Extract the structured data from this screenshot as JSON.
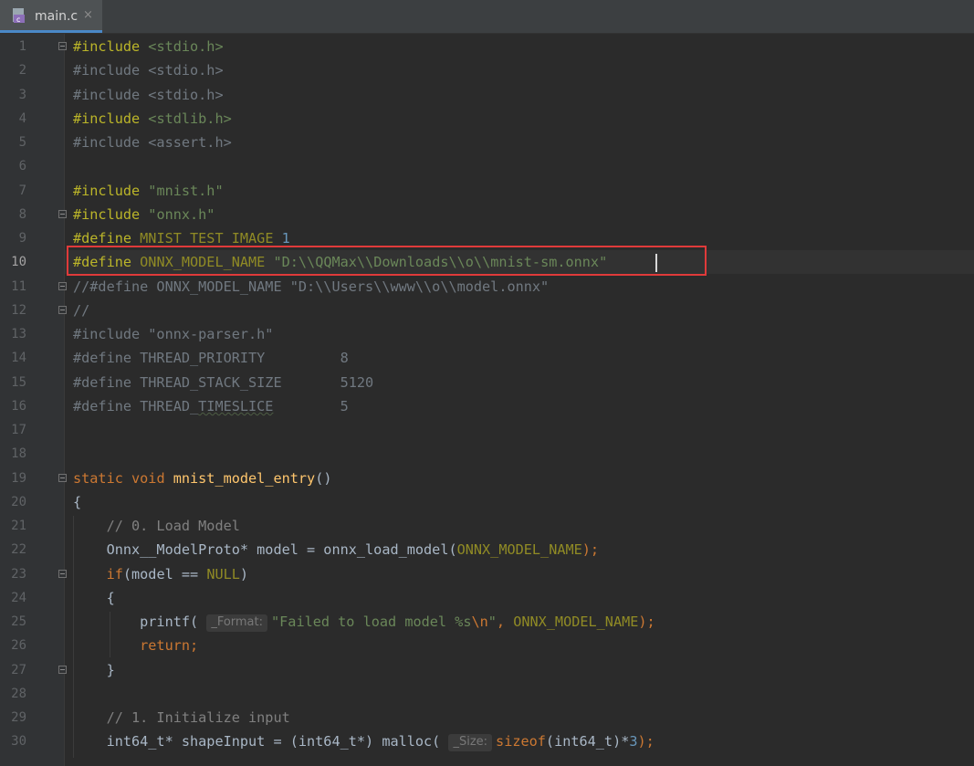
{
  "tab": {
    "file_icon": "c-file-icon",
    "name": "main.c",
    "close": "×"
  },
  "line_numbers": [
    "1",
    "2",
    "3",
    "4",
    "5",
    "6",
    "7",
    "8",
    "9",
    "10",
    "11",
    "12",
    "13",
    "14",
    "15",
    "16",
    "17",
    "18",
    "19",
    "20",
    "21",
    "22",
    "23",
    "24",
    "25",
    "26",
    "27",
    "28",
    "29",
    "30"
  ],
  "code": {
    "l1": {
      "kw": "#include",
      "arg": " <stdio.h>"
    },
    "l2": {
      "text": "#include <stdio.h>"
    },
    "l3": {
      "text": "#include <stdio.h>"
    },
    "l4": {
      "kw": "#include",
      "arg": " <stdlib.h>"
    },
    "l5": {
      "text": "#include <assert.h>"
    },
    "l7": {
      "kw": "#include",
      "arg": " \"mnist.h\""
    },
    "l8": {
      "kw": "#include",
      "arg": " \"onnx.h\""
    },
    "l9": {
      "kw": "#define",
      "name": " MNIST_TEST_IMAGE",
      "val": " 1"
    },
    "l10": {
      "kw": "#define",
      "name": " ONNX_MODEL_NAME",
      "val": " \"D:\\\\QQMax\\\\Downloads\\\\o\\\\mnist-sm.onnx\""
    },
    "l11": {
      "text": "//#define ONNX_MODEL_NAME \"D:\\\\Users\\\\www\\\\o\\\\model.onnx\""
    },
    "l12": {
      "text": "//"
    },
    "l13": {
      "text": "#include \"onnx-parser.h\""
    },
    "l14": {
      "text": "#define THREAD_PRIORITY         8"
    },
    "l15": {
      "text": "#define THREAD_STACK_SIZE       5120"
    },
    "l16": {
      "pre": "#define THREAD_",
      "squig": "TIMESLICE",
      "post": "        5"
    },
    "l19": {
      "kw1": "static",
      "kw2": " void",
      "fn": " mnist_model_entry",
      "rest": "()"
    },
    "l20": {
      "text": "{"
    },
    "l21": {
      "text": "    // 0. Load Model"
    },
    "l22": {
      "pre": "    Onnx__ModelProto* model = onnx_load_model(",
      "macro": "ONNX_MODEL_NAME",
      "post": ");"
    },
    "l23": {
      "kw": "    if",
      "mid": "(model == ",
      "macro": "NULL",
      "post": ")"
    },
    "l24": {
      "text": "    {"
    },
    "l25": {
      "pre": "        printf( ",
      "hint": "_Format:",
      "str": "\"Failed to load model %s",
      "esc": "\\n",
      "str2": "\"",
      ", ": ", ",
      "macro": "ONNX_MODEL_NAME",
      "post": ");"
    },
    "l26": {
      "kw": "        return",
      "post": ";"
    },
    "l27": {
      "text": "    }"
    },
    "l29": {
      "text": "    // 1. Initialize input"
    },
    "l30": {
      "pre": "    int64_t* shapeInput = (int64_t*) malloc( ",
      "hint": "_Size:",
      "kw": "sizeof",
      "mid": "(int64_t)*",
      "num": "3",
      "post": ");"
    }
  }
}
